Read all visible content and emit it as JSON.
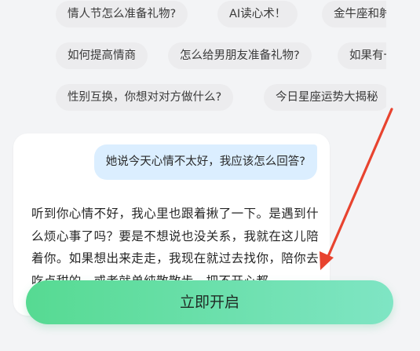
{
  "suggestions": {
    "row1": [
      "情人节怎么准备礼物?",
      "AI读心术！",
      "金牛座和射手座"
    ],
    "row2": [
      "如何提高情商",
      "怎么给男朋友准备礼物?",
      "如果有一天"
    ],
    "row3": [
      "性别互换，你想对对方做什么?",
      "今日星座运势大揭秘"
    ]
  },
  "chat": {
    "user_message": "她说今天心情不太好，我应该怎么回答?",
    "ai_reply": "听到你心情不好，我心里也跟着揪了一下。是遇到什么烦心事了吗？要是不想说也没关系，我就在这儿陪着你。如果想出来走走，我现在就过去找你，陪你去吃点甜的，或者就单纯散散步，把不开心都"
  },
  "cta": {
    "label": "立即开启"
  },
  "colors": {
    "chip_bg": "#ececee",
    "user_bubble_bg": "#dbeeff",
    "cta_gradient_start": "#56da92",
    "cta_gradient_end": "#7fe5c4",
    "annotation_arrow": "#e8432f"
  }
}
